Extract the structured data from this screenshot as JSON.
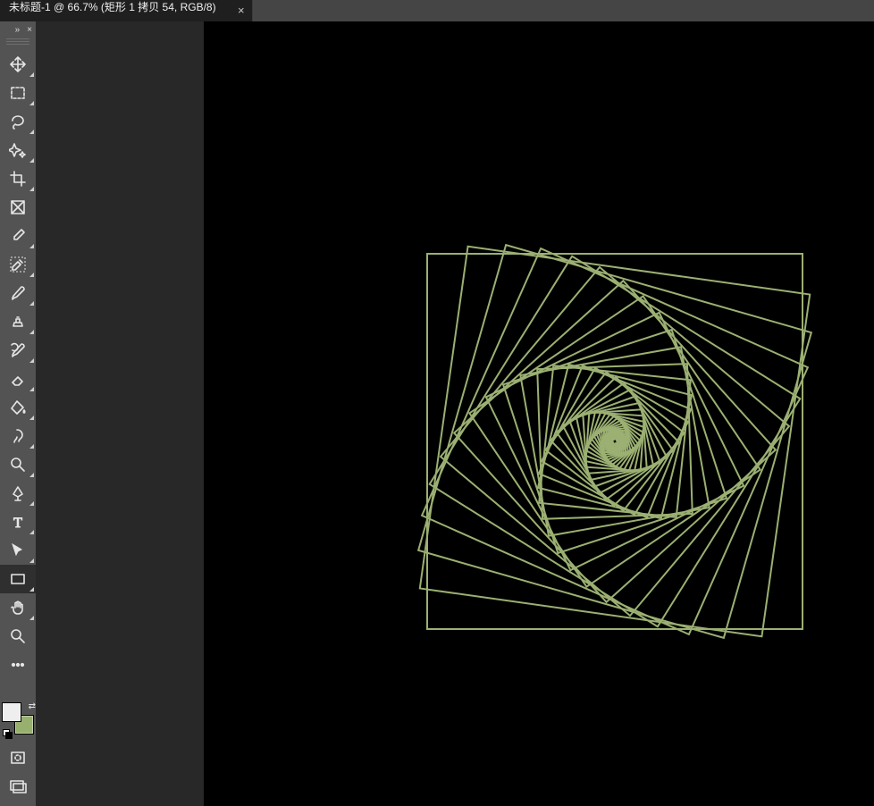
{
  "document_tab": {
    "label": "未标题-1 @ 66.7% (矩形 1 拷贝 54, RGB/8)",
    "close_glyph": "×"
  },
  "toolbox_header": {
    "collapse_glyph": "»",
    "close_glyph": "×"
  },
  "tools": [
    {
      "id": "move-tool",
      "flyout": true
    },
    {
      "id": "rect-marquee-tool",
      "flyout": true
    },
    {
      "id": "lasso-tool",
      "flyout": true
    },
    {
      "id": "quick-select-tool",
      "flyout": true
    },
    {
      "id": "crop-tool",
      "flyout": true
    },
    {
      "id": "frame-tool",
      "flyout": false
    },
    {
      "id": "eyedropper-tool",
      "flyout": true
    },
    {
      "id": "healing-brush-tool",
      "flyout": true
    },
    {
      "id": "brush-tool",
      "flyout": true
    },
    {
      "id": "clone-stamp-tool",
      "flyout": true
    },
    {
      "id": "history-brush-tool",
      "flyout": true
    },
    {
      "id": "eraser-tool",
      "flyout": true
    },
    {
      "id": "paint-bucket-tool",
      "flyout": true
    },
    {
      "id": "smudge-tool",
      "flyout": true
    },
    {
      "id": "dodge-tool",
      "flyout": true
    },
    {
      "id": "pen-tool",
      "flyout": true
    },
    {
      "id": "type-tool",
      "flyout": true
    },
    {
      "id": "path-select-tool",
      "flyout": true
    },
    {
      "id": "rectangle-shape-tool",
      "flyout": true,
      "selected": true
    },
    {
      "id": "hand-tool",
      "flyout": true
    },
    {
      "id": "zoom-tool",
      "flyout": false
    },
    {
      "id": "more-tools",
      "flyout": false
    }
  ],
  "bottom_tools": [
    {
      "id": "quick-mask-mode"
    },
    {
      "id": "screen-mode-toggle"
    }
  ],
  "colors": {
    "foreground": "#eeeeee",
    "background": "#98b06e",
    "swap_glyph": "⇄"
  },
  "artwork": {
    "stroke": "#9bb072",
    "center_x": 0,
    "center_y": 0,
    "squares_count": 55,
    "initial_half_size": 210,
    "scale_step": 0.92,
    "rotation_step_deg": 8
  }
}
